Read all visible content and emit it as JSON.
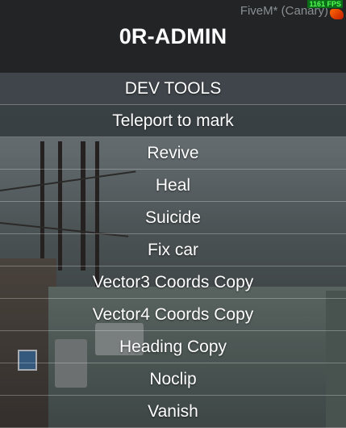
{
  "overlay": {
    "app_name": "FiveM* (Canary)",
    "fps_badge": "1161 FPS"
  },
  "menu": {
    "title": "0R-ADMIN",
    "section": "DEV TOOLS",
    "selected_index": 0,
    "items": [
      "Teleport to mark",
      "Revive",
      "Heal",
      "Suicide",
      "Fix car",
      "Vector3 Coords Copy",
      "Vector4 Coords Copy",
      "Heading Copy",
      "Noclip",
      "Vanish"
    ]
  }
}
